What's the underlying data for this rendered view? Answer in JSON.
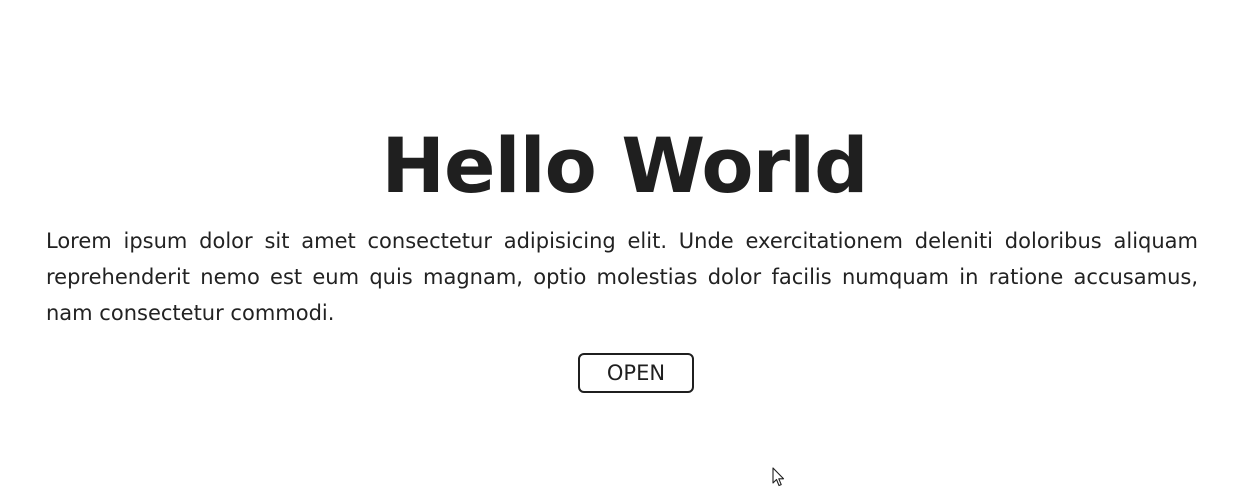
{
  "hero": {
    "title": "Hello World",
    "paragraph": "Lorem ipsum dolor sit amet consectetur adipisicing elit. Unde exercitationem deleniti doloribus aliquam reprehenderit nemo est eum quis magnam, optio molestias dolor facilis numquam in ratione accusamus, nam consectetur commodi.",
    "button_label": "OPEN"
  },
  "icons": {
    "cursor": "mouse-pointer-icon"
  },
  "colors": {
    "text": "#1f1f1f",
    "background": "#ffffff",
    "button_border": "#1f1f1f"
  }
}
